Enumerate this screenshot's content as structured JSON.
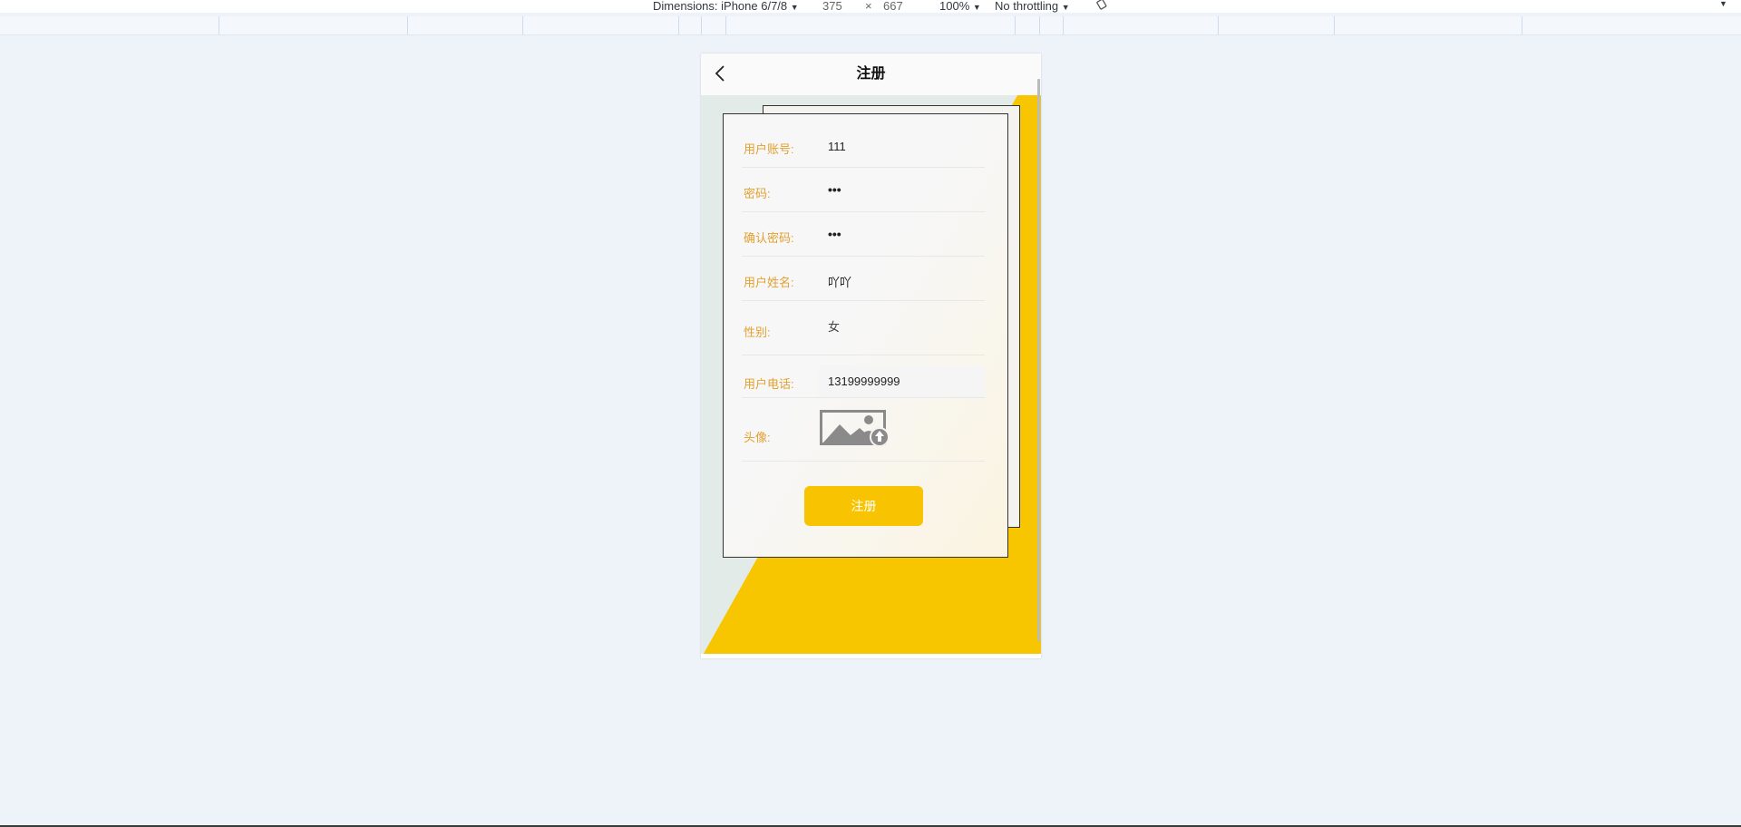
{
  "devtools": {
    "dimensions_label": "Dimensions: iPhone 6/7/8",
    "width": "375",
    "times": "×",
    "height": "667",
    "zoom": "100%",
    "throttling": "No throttling",
    "caret": "▼"
  },
  "page": {
    "title": "注册",
    "back_icon": "chevron-left-icon"
  },
  "form": {
    "account": {
      "label": "用户账号:",
      "value": "111"
    },
    "password": {
      "label": "密码:",
      "value": "•••"
    },
    "confirm_password": {
      "label": "确认密码:",
      "value": "•••"
    },
    "name": {
      "label": "用户姓名:",
      "value": "吖吖"
    },
    "gender": {
      "label": "性别:",
      "value": "女"
    },
    "phone": {
      "label": "用户电话:",
      "value": "13199999999"
    },
    "avatar": {
      "label": "头像:",
      "icon": "image-upload-icon"
    },
    "submit_label": "注册"
  },
  "colors": {
    "accent": "#f8c600",
    "label": "#e2a030",
    "background": "#eef2f9"
  }
}
